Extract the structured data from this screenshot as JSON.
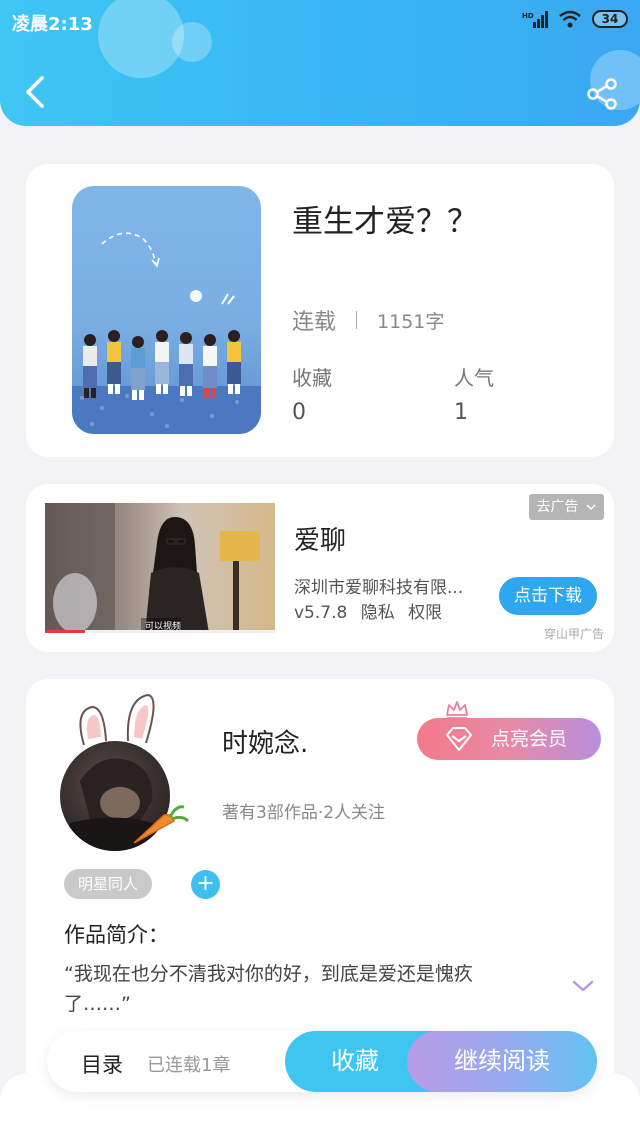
{
  "status_bar": {
    "time": "凌晨2:13",
    "signal": "HD",
    "battery": "34"
  },
  "header": {
    "back_icon": "chevron-left-icon",
    "share_icon": "share-icon"
  },
  "book": {
    "title": "重生才爱？？",
    "status": "连载",
    "word_count": "1151字",
    "favorites_label": "收藏",
    "favorites_value": "0",
    "popularity_label": "人气",
    "popularity_value": "1"
  },
  "ad": {
    "title": "爱聊",
    "company": "深圳市爱聊科技有限...",
    "version": "v5.7.8",
    "privacy": "隐私",
    "permissions": "权限",
    "remove_label": "去广告",
    "download_label": "点击下载",
    "source": "穿山甲广告",
    "video_caption": "可以视频"
  },
  "author": {
    "name": "时婉念.",
    "info": "著有3部作品·2人关注",
    "vip_label": "点亮会员",
    "tag": "明星同人",
    "add_label": "+",
    "intro_title": "作品简介：",
    "intro_text": "“我现在也分不清我对你的好，到底是爱还是愧疚了……”"
  },
  "bottom_bar": {
    "toc_label": "目录",
    "chapter_count": "已连载1章",
    "favorite_label": "收藏",
    "read_label": "继续阅读"
  },
  "colors": {
    "header_gradient_start": "#3fc6f3",
    "header_gradient_end": "#3aa8f2",
    "accent_blue": "#2ea7ef",
    "vip_gradient_start": "#f27a8a",
    "vip_gradient_end": "#b98ee0"
  }
}
